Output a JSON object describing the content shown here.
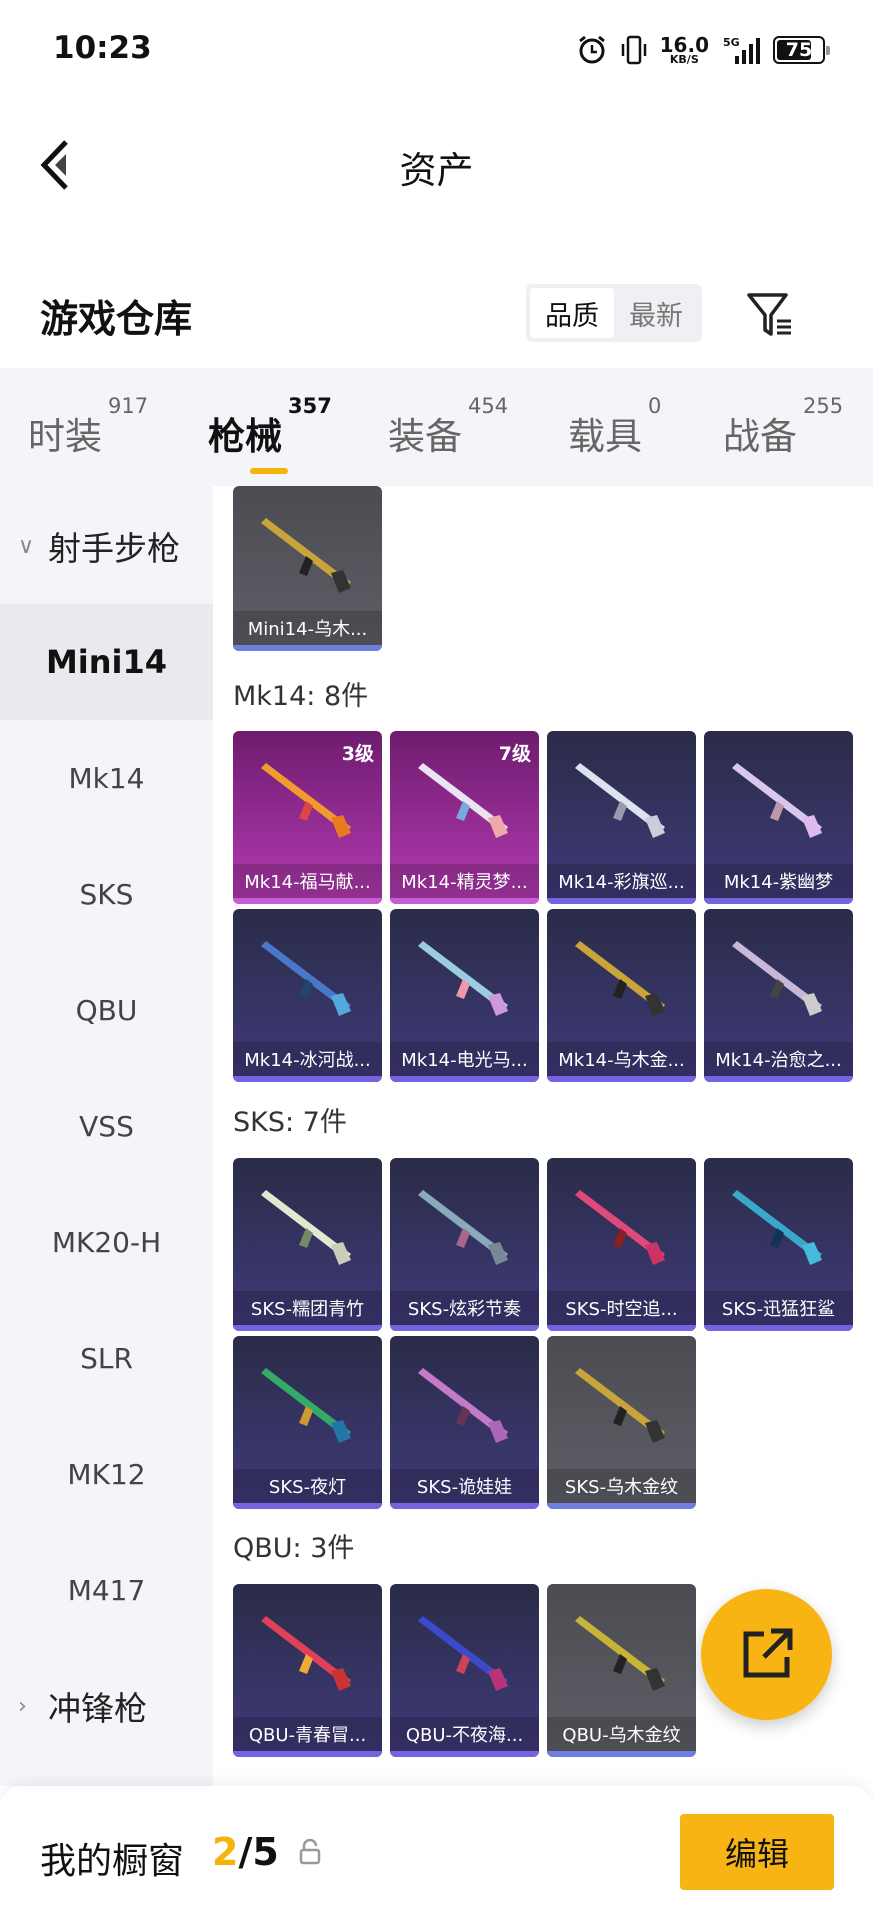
{
  "status": {
    "time": "10:23",
    "speed_value": "16.0",
    "speed_unit": "KB/S",
    "network": "5G",
    "battery": "75"
  },
  "nav": {
    "title": "资产"
  },
  "warehouse": {
    "title": "游戏仓库",
    "sort_quality": "品质",
    "sort_latest": "最新"
  },
  "tabs": [
    {
      "label": "时装",
      "count": "917"
    },
    {
      "label": "枪械",
      "count": "357"
    },
    {
      "label": "装备",
      "count": "454"
    },
    {
      "label": "载具",
      "count": "0"
    },
    {
      "label": "战备",
      "count": "255"
    }
  ],
  "sidebar": {
    "cat1": "射手步枪",
    "items": [
      "Mini14",
      "Mk14",
      "SKS",
      "QBU",
      "VSS",
      "MK20-H",
      "SLR",
      "MK12",
      "M417"
    ],
    "cat2": "冲锋枪"
  },
  "sections": {
    "mini14": {
      "items": [
        "Mini14-乌木..."
      ]
    },
    "mk14": {
      "header": "Mk14: 8件",
      "items": [
        "Mk14-福马献...",
        "Mk14-精灵梦...",
        "Mk14-彩旗巡...",
        "Mk14-紫幽梦",
        "Mk14-冰河战...",
        "Mk14-电光马...",
        "Mk14-乌木金...",
        "Mk14-治愈之..."
      ],
      "levels": [
        "3级",
        "7级"
      ]
    },
    "sks": {
      "header": "SKS: 7件",
      "items": [
        "SKS-糯团青竹",
        "SKS-炫彩节奏",
        "SKS-时空追...",
        "SKS-迅猛狂鲨",
        "SKS-夜灯",
        "SKS-诡娃娃",
        "SKS-乌木金纹"
      ]
    },
    "qbu": {
      "header": "QBU: 3件",
      "items": [
        "QBU-青春冒...",
        "QBU-不夜海...",
        "QBU-乌木金纹"
      ]
    }
  },
  "showcase": {
    "label": "我的橱窗",
    "current": "2",
    "separator": "/",
    "total": "5",
    "edit_label": "编辑"
  },
  "colors": {
    "accent": "#f8b412",
    "rare_card": "#403a7a",
    "legend_card": "#b53bb3",
    "basic_card": "#5f6067"
  }
}
